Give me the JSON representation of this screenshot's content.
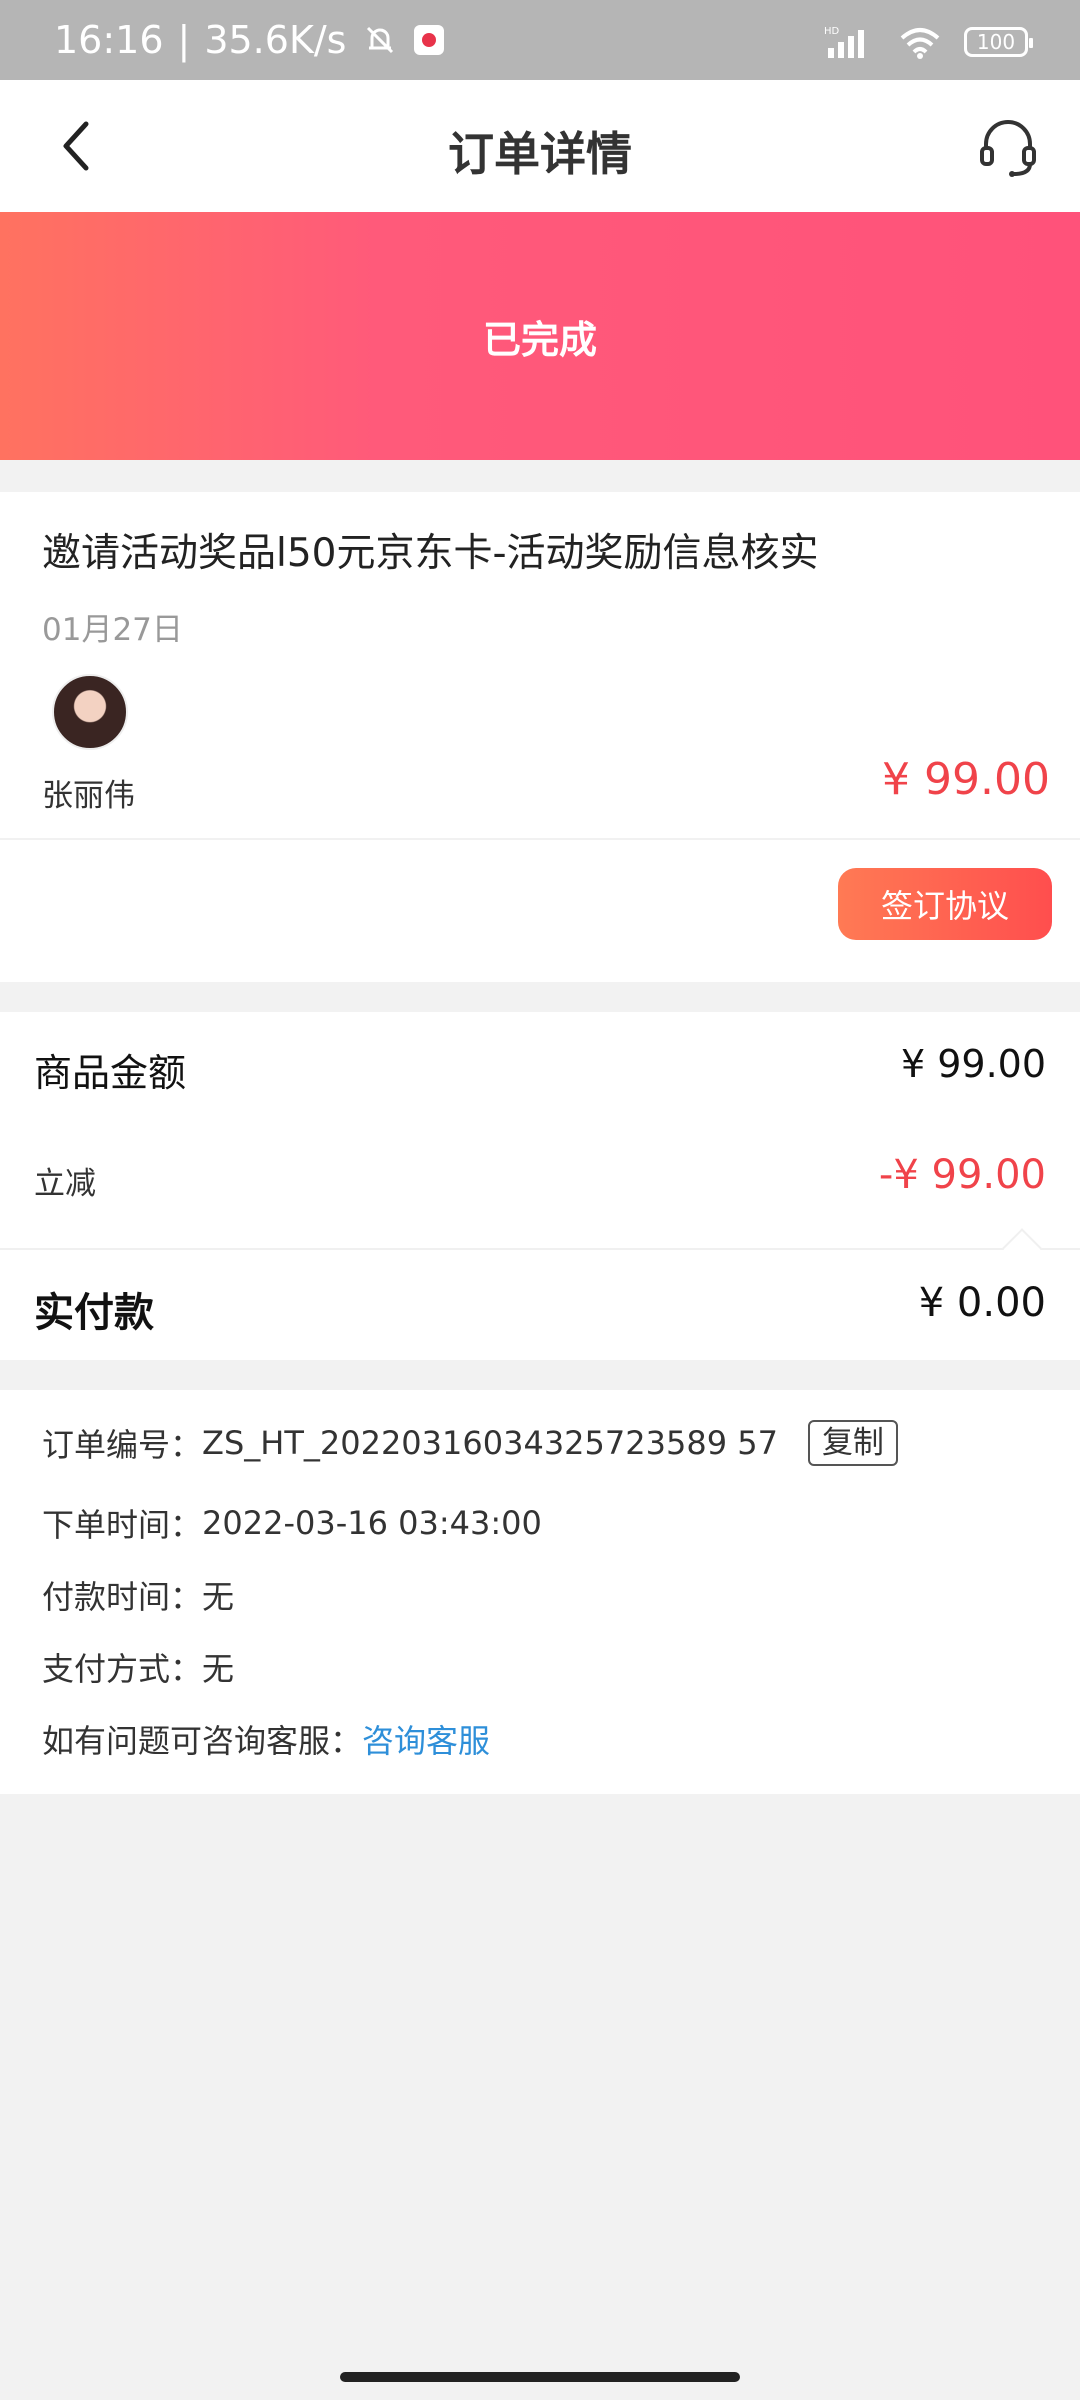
{
  "status_bar": {
    "time": "16:16",
    "separator": "|",
    "speed": "35.6K/s",
    "hd": "HD",
    "battery": "100"
  },
  "nav": {
    "title": "订单详情",
    "back_icon": "chevron-left-icon",
    "service_icon": "headset-icon"
  },
  "order_status": "已完成",
  "product": {
    "title": "邀请活动奖品l50元京东卡-活动奖励信息核实",
    "date": "01月27日",
    "author": "张丽伟",
    "price": "¥ 99.00",
    "sign_button": "签订协议"
  },
  "amounts": {
    "goods_label": "商品金额",
    "goods_value": "¥ 99.00",
    "discount_label": "立减",
    "discount_value": "-¥ 99.00",
    "paid_label": "实付款",
    "paid_value": "¥ 0.00"
  },
  "order_info": {
    "order_no_label": "订单编号：",
    "order_no_value": "ZS_HT_20220316034325723589 57",
    "copy_button": "复制",
    "order_time_label": "下单时间：",
    "order_time_value": "2022-03-16 03:43:00",
    "pay_time_label": "付款时间：",
    "pay_time_value": "无",
    "pay_method_label": "支付方式：",
    "pay_method_value": "无",
    "help_label": "如有问题可咨询客服：",
    "help_link": "咨询客服"
  },
  "colors": {
    "accent_red": "#f0434a",
    "banner_start": "#ff7260",
    "banner_end": "#ff527a",
    "link_blue": "#2e8fd9"
  }
}
